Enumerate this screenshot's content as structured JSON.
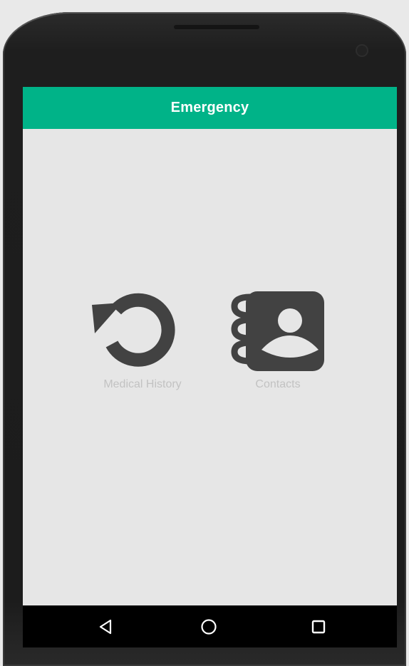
{
  "app": {
    "title": "Emergency"
  },
  "colors": {
    "accent": "#00b388",
    "screen_background": "#e6e6e6",
    "icon": "#424242",
    "label": "#c2c2c2",
    "nav_background": "#000000"
  },
  "main": {
    "tiles": [
      {
        "label": "Medical History",
        "icon": "history-icon"
      },
      {
        "label": "Contacts",
        "icon": "contacts-book-icon"
      }
    ]
  },
  "navbar": {
    "buttons": [
      {
        "name": "back",
        "icon": "back-triangle-icon"
      },
      {
        "name": "home",
        "icon": "home-circle-icon"
      },
      {
        "name": "recents",
        "icon": "recents-square-icon"
      }
    ]
  }
}
